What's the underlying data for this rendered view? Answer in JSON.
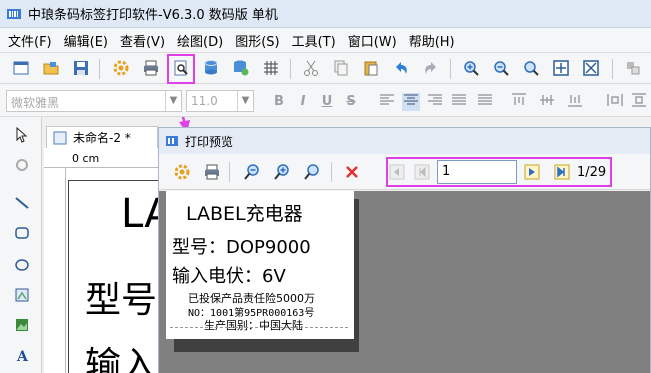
{
  "window": {
    "title": "中琅条码标签打印软件-V6.3.0 数码版 单机"
  },
  "menu": {
    "items": [
      "文件(F)",
      "编辑(E)",
      "查看(V)",
      "绘图(D)",
      "图形(S)",
      "工具(T)",
      "窗口(W)",
      "帮助(H)"
    ]
  },
  "format_toolbar": {
    "font_name": "微软雅黑",
    "font_size": "11.0",
    "buttons": [
      "B",
      "I",
      "U",
      "S"
    ]
  },
  "document": {
    "tab_label": "未命名-2 *",
    "ruler_label": "0 cm",
    "canvas_text_1": "LA",
    "canvas_text_2": "型号",
    "canvas_text_3": "输入"
  },
  "preview": {
    "title": "打印预览",
    "page_input": "1",
    "page_count": "1/29",
    "label": {
      "line1": "LABEL充电器",
      "line2": "型号：DOP9000",
      "line3": "输入电伏：6V",
      "line4": "已投保产品责任险5000万",
      "line5": "NO：1001第95PR000163号",
      "line6": "生产国别：中国大陆"
    }
  },
  "colors": {
    "highlight": "#e040e8",
    "titlebar": "#dfe9f5",
    "viewport_bg": "#808080"
  }
}
